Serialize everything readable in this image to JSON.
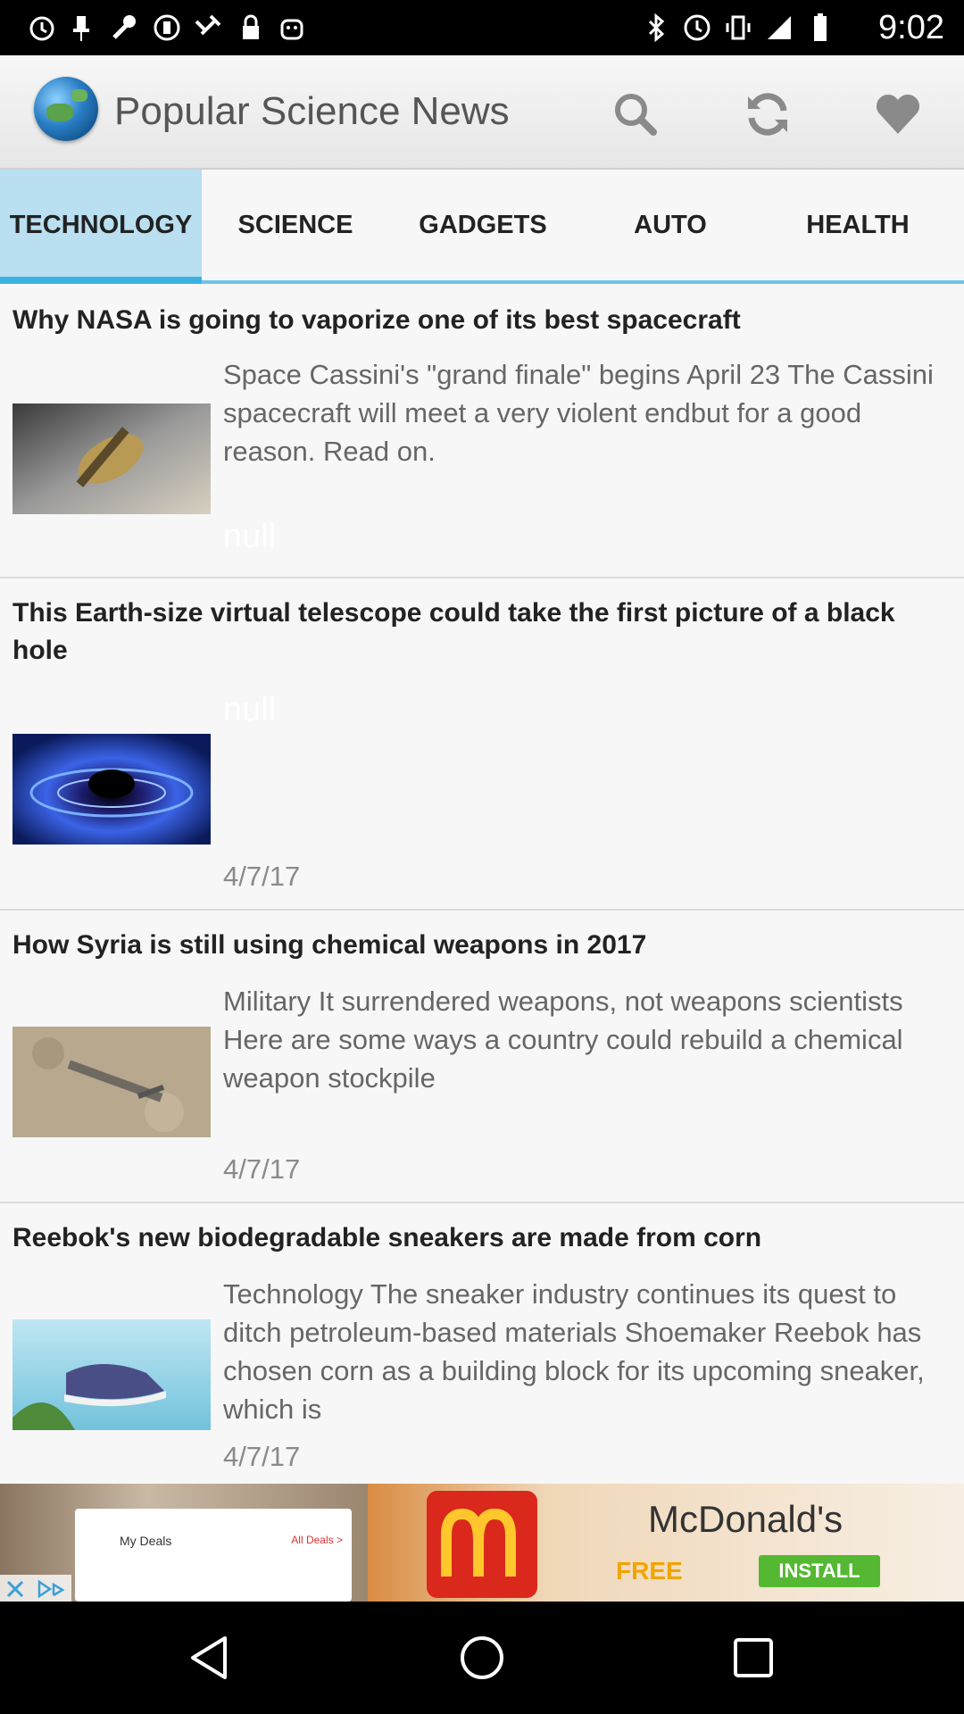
{
  "status_bar": {
    "time": "9:02",
    "left_icons": [
      "alarm-icon",
      "pin-icon",
      "wrench-icon",
      "circle-icon",
      "satellite-icon",
      "lock-icon",
      "android-icon"
    ],
    "right_icons": [
      "bluetooth-icon",
      "clock-icon",
      "vibrate-icon",
      "signal-icon",
      "battery-icon"
    ]
  },
  "app_bar": {
    "title": "Popular Science News",
    "actions": [
      "search-icon",
      "refresh-icon",
      "heart-icon"
    ]
  },
  "tabs": [
    {
      "label": "TECHNOLOGY",
      "active": true
    },
    {
      "label": "SCIENCE",
      "active": false
    },
    {
      "label": "GADGETS",
      "active": false
    },
    {
      "label": "AUTO",
      "active": false
    },
    {
      "label": "HEALTH",
      "active": false
    }
  ],
  "articles": [
    {
      "title": "Why NASA is going to vaporize one of its best spacecraft",
      "description": "Space Cassini's \"grand finale\" begins April 23 The Cassini spacecraft will meet a very violent endbut for a good reason. Read on.",
      "footer": "null",
      "thumb": "cassini-spacecraft"
    },
    {
      "title": "This Earth-size virtual telescope could take the first picture of a black hole",
      "description": "null",
      "footer": "4/7/17",
      "thumb": "black-hole"
    },
    {
      "title": "How Syria is still using chemical weapons in 2017",
      "description": "Military It surrendered weapons, not weapons scientists Here are some ways a country could rebuild a chemical weapon stockpile",
      "footer": "4/7/17",
      "thumb": "weapon-on-ground"
    },
    {
      "title": "Reebok's new biodegradable sneakers are made from corn",
      "description": "Technology The sneaker industry continues its quest to ditch petroleum-based materials Shoemaker Reebok has chosen corn as a building block for its upcoming sneaker, which is",
      "footer": "4/7/17",
      "thumb": "sneaker"
    }
  ],
  "ad": {
    "deals_title": "My Deals",
    "deals_link": "All Deals >",
    "brand": "McDonald's",
    "free_label": "FREE",
    "install_label": "INSTALL"
  },
  "nav_bar": [
    "back-icon",
    "home-icon",
    "recents-icon"
  ],
  "colors": {
    "accent": "#3ab3e3",
    "active_tab_bg": "#b9dff0",
    "install_green": "#55b832",
    "mcd_red": "#da291c"
  }
}
